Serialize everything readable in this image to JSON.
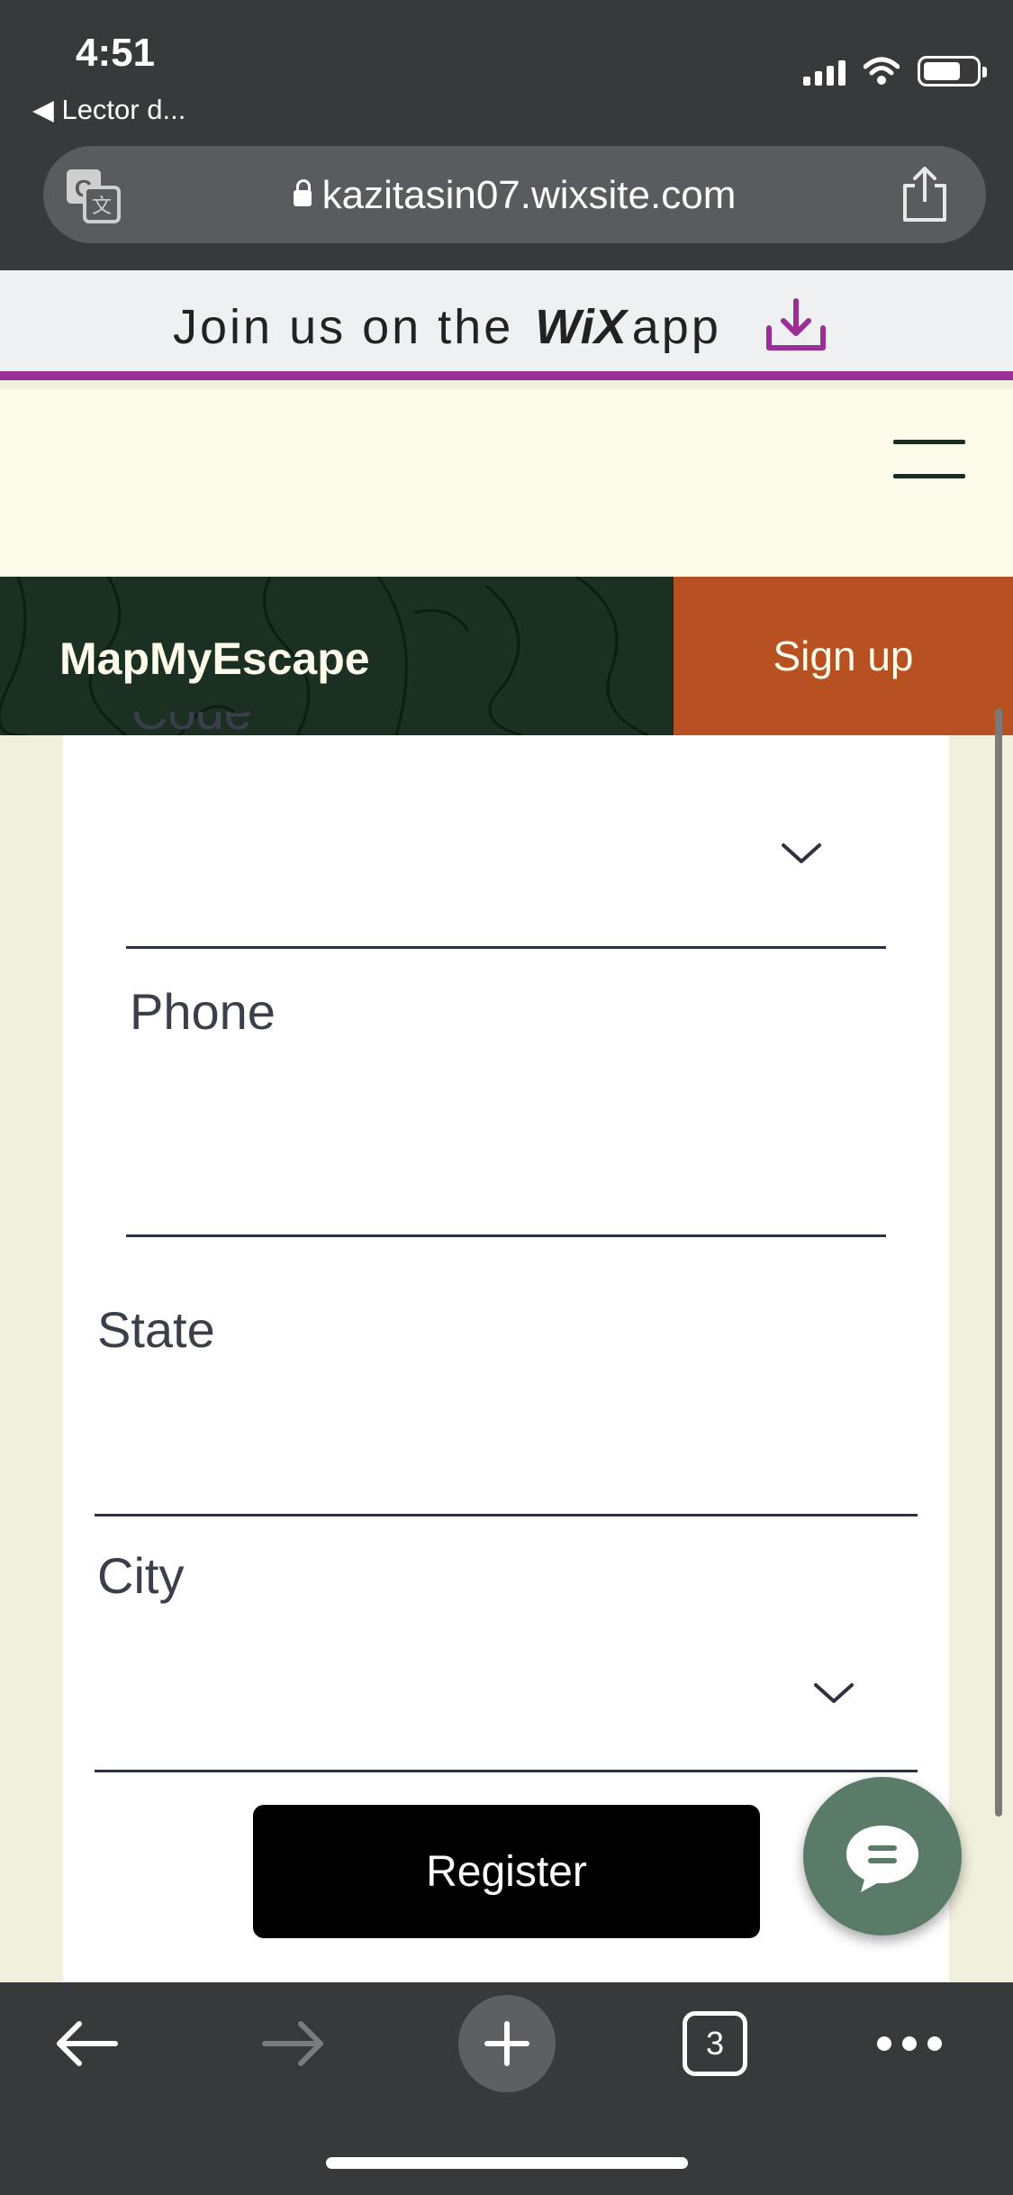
{
  "status_bar": {
    "time": "4:51",
    "back_app": "◀ Lector d..."
  },
  "browser": {
    "url": "kazitasin07.wixsite.com",
    "tab_count": "3"
  },
  "wix_banner": {
    "prefix": "Join us on the",
    "logo": "WiX",
    "suffix": "app"
  },
  "site": {
    "brand": "MapMyEscape",
    "signup_label": "Sign up"
  },
  "form": {
    "top_field_label_cut": "Code",
    "phone_label": "Phone",
    "state_label": "State",
    "city_label": "City",
    "register_label": "Register"
  },
  "colors": {
    "chrome": "#38393b",
    "brand_green": "#1b3022",
    "signup_orange": "#b85121",
    "wix_purple": "#9b2f98",
    "cream": "#fdfbea",
    "chat_green": "#5b7b69"
  }
}
